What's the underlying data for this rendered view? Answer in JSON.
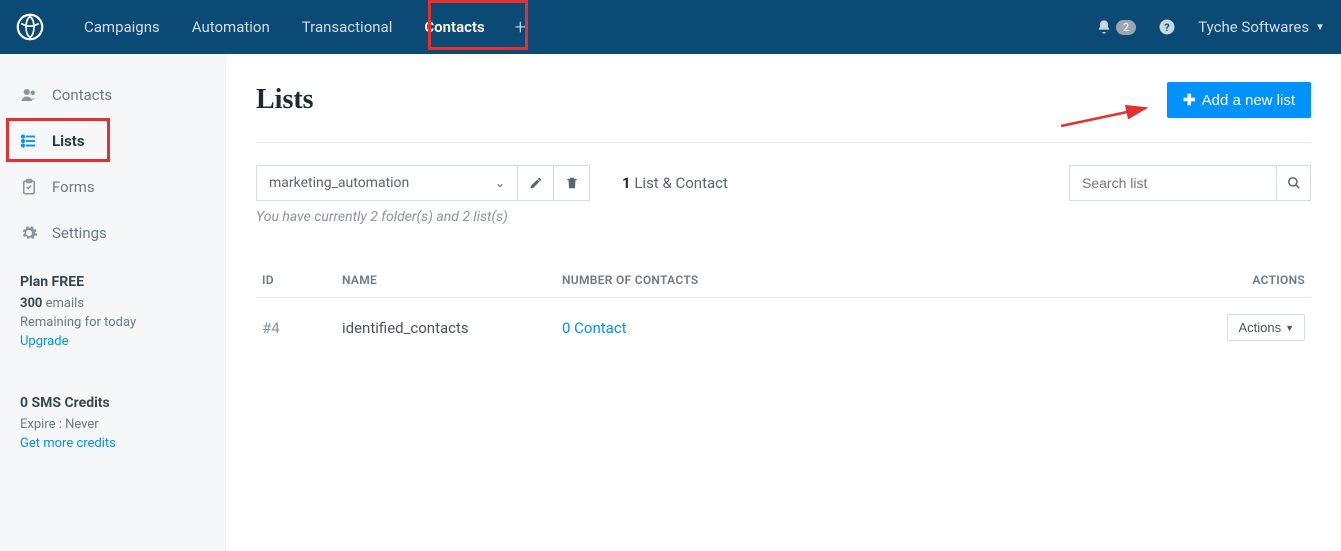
{
  "topnav": {
    "items": [
      "Campaigns",
      "Automation",
      "Transactional",
      "Contacts"
    ],
    "active_index": 3,
    "notifications_count": "2",
    "account_name": "Tyche Softwares"
  },
  "sidebar": {
    "items": [
      {
        "label": "Contacts",
        "icon": "users"
      },
      {
        "label": "Lists",
        "icon": "list"
      },
      {
        "label": "Forms",
        "icon": "clipboard"
      },
      {
        "label": "Settings",
        "icon": "gear"
      }
    ],
    "active_index": 1,
    "plan": {
      "title": "Plan FREE",
      "emails_count": "300",
      "emails_label": "emails",
      "remaining_label": "Remaining for today",
      "upgrade_label": "Upgrade"
    },
    "sms": {
      "title": "0 SMS Credits",
      "expire_label": "Expire : Never",
      "credits_link": "Get more credits"
    }
  },
  "main": {
    "title": "Lists",
    "add_button": "Add a new list",
    "folder_selected": "marketing_automation",
    "list_count_bold": "1",
    "list_count_text": "List & Contact",
    "search_placeholder": "Search list",
    "folder_info": "You have currently 2 folder(s) and 2 list(s)"
  },
  "table": {
    "headers": {
      "id": "ID",
      "name": "NAME",
      "count": "NUMBER OF CONTACTS",
      "actions": "ACTIONS"
    },
    "rows": [
      {
        "id": "#4",
        "name": "identified_contacts",
        "count": "0 Contact",
        "actions_label": "Actions"
      }
    ]
  }
}
